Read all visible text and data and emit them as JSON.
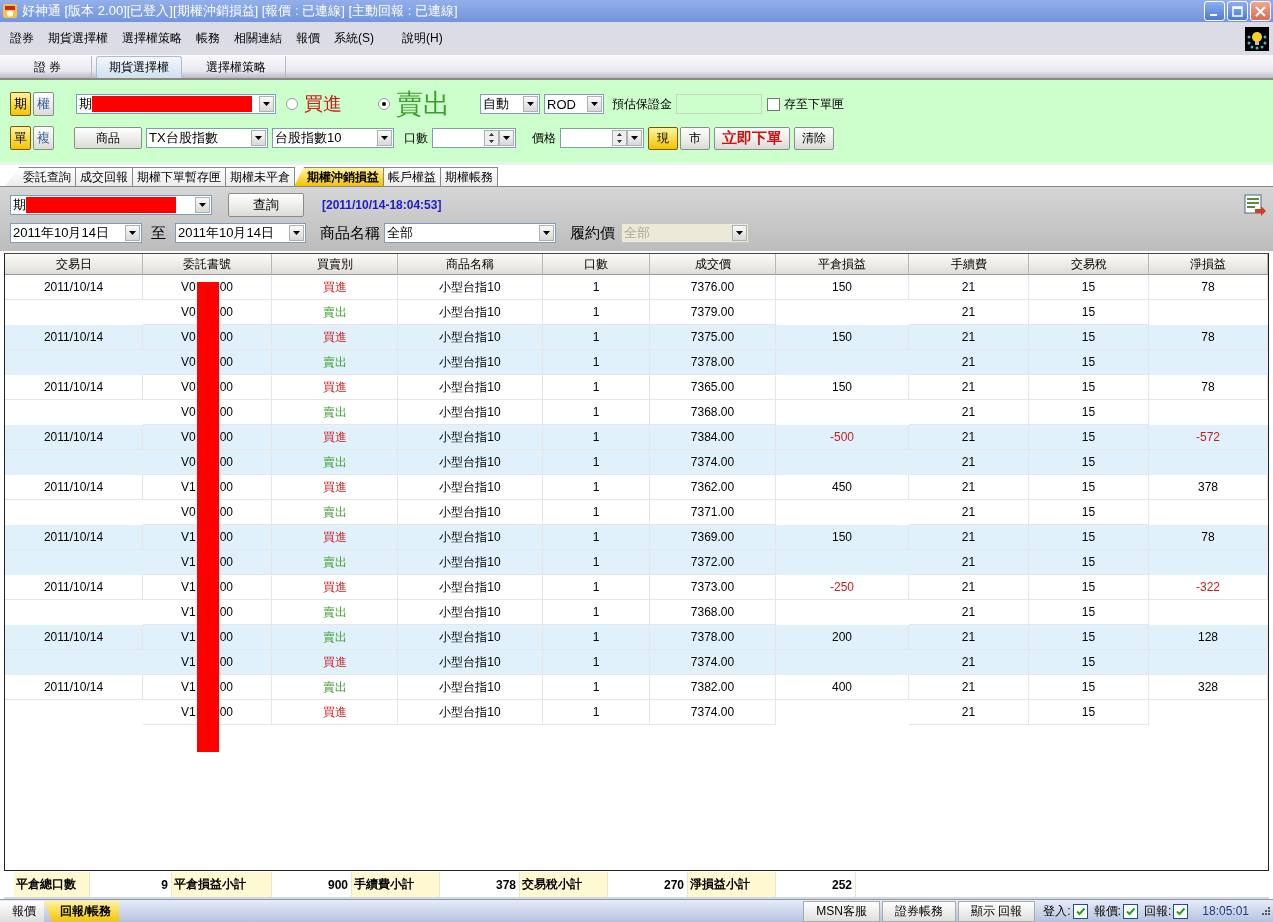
{
  "window": {
    "title": "好神通 [版本 2.00][已登入][期權沖銷損益] [報價 : 已連線] [主動回報 : 已連線]"
  },
  "menu": [
    "證券",
    "期貨選擇權",
    "選擇權策略",
    "帳務",
    "相關連結",
    "報價",
    "系統(S)",
    "說明(H)"
  ],
  "main_tabs": [
    {
      "label": "證 券",
      "selected": false
    },
    {
      "label": "期貨選擇權",
      "selected": true
    },
    {
      "label": "選擇權策略",
      "selected": false
    }
  ],
  "order_panel": {
    "market_toggle": [
      {
        "label": "期",
        "selected": true
      },
      {
        "label": "權",
        "selected": false
      }
    ],
    "account": "期",
    "side": [
      {
        "label": "買進",
        "selected": false,
        "kind": "buy"
      },
      {
        "label": "賣出",
        "selected": true,
        "kind": "sell"
      }
    ],
    "condition": "自動",
    "order_type": "ROD",
    "margin_label": "預估保證金",
    "save_to_box": {
      "label": "存至下單匣",
      "checked": false
    },
    "mode_toggle": [
      {
        "label": "單",
        "selected": true
      },
      {
        "label": "複",
        "selected": false
      }
    ],
    "product_button": "商品",
    "product_combo": "TX台股指數",
    "contract_combo": "台股指數10",
    "qty_label": "口數",
    "price_label": "價格",
    "price_type": [
      {
        "label": "現",
        "selected": true
      },
      {
        "label": "市",
        "selected": false
      }
    ],
    "submit_button": "立即下單",
    "clear_button": "清除"
  },
  "sub_tabs": [
    {
      "label": "委託查詢",
      "selected": false
    },
    {
      "label": "成交回報",
      "selected": false
    },
    {
      "label": "期權下單暫存匣",
      "selected": false
    },
    {
      "label": "期權未平倉",
      "selected": false
    },
    {
      "label": "期權沖銷損益",
      "selected": true
    },
    {
      "label": "帳戶權益",
      "selected": false
    },
    {
      "label": "期權帳務",
      "selected": false
    }
  ],
  "filter": {
    "account": "期",
    "query_button": "查詢",
    "timestamp": "[2011/10/14-18:04:53]",
    "date_from": "2011年10月14日",
    "to_label": "至",
    "date_to": "2011年10月14日",
    "product_label": "商品名稱",
    "product": "全部",
    "strike_label": "履約價",
    "strike": {
      "value": "全部",
      "disabled": true
    }
  },
  "table": {
    "columns": [
      "交易日",
      "委託書號",
      "買賣別",
      "商品名稱",
      "口數",
      "成交價",
      "平倉損益",
      "手續費",
      "交易稅",
      "淨損益"
    ],
    "rows": [
      {
        "date": "2011/10/14",
        "order_prefix": "V0",
        "order_suffix": "00",
        "side": "買進",
        "kind": "buy",
        "product": "小型台指10",
        "qty": "1",
        "price": "7376.00",
        "pnl": "150",
        "fee": "21",
        "tax": "15",
        "net": "78",
        "loss": false
      },
      {
        "order_prefix": "V0",
        "order_suffix": "00",
        "side": "賣出",
        "kind": "sell",
        "product": "小型台指10",
        "qty": "1",
        "price": "7379.00",
        "fee": "21",
        "tax": "15"
      },
      {
        "date": "2011/10/14",
        "order_prefix": "V0",
        "order_suffix": "00",
        "side": "買進",
        "kind": "buy",
        "product": "小型台指10",
        "qty": "1",
        "price": "7375.00",
        "pnl": "150",
        "fee": "21",
        "tax": "15",
        "net": "78",
        "loss": false
      },
      {
        "order_prefix": "V0",
        "order_suffix": "00",
        "side": "賣出",
        "kind": "sell",
        "product": "小型台指10",
        "qty": "1",
        "price": "7378.00",
        "fee": "21",
        "tax": "15"
      },
      {
        "date": "2011/10/14",
        "order_prefix": "V0",
        "order_suffix": "00",
        "side": "買進",
        "kind": "buy",
        "product": "小型台指10",
        "qty": "1",
        "price": "7365.00",
        "pnl": "150",
        "fee": "21",
        "tax": "15",
        "net": "78",
        "loss": false
      },
      {
        "order_prefix": "V0",
        "order_suffix": "00",
        "side": "賣出",
        "kind": "sell",
        "product": "小型台指10",
        "qty": "1",
        "price": "7368.00",
        "fee": "21",
        "tax": "15"
      },
      {
        "date": "2011/10/14",
        "order_prefix": "V0",
        "order_suffix": "00",
        "side": "買進",
        "kind": "buy",
        "product": "小型台指10",
        "qty": "1",
        "price": "7384.00",
        "pnl": "-500",
        "fee": "21",
        "tax": "15",
        "net": "-572",
        "loss": true
      },
      {
        "order_prefix": "V0",
        "order_suffix": "00",
        "side": "賣出",
        "kind": "sell",
        "product": "小型台指10",
        "qty": "1",
        "price": "7374.00",
        "fee": "21",
        "tax": "15"
      },
      {
        "date": "2011/10/14",
        "order_prefix": "V1",
        "order_suffix": "00",
        "side": "買進",
        "kind": "buy",
        "product": "小型台指10",
        "qty": "1",
        "price": "7362.00",
        "pnl": "450",
        "fee": "21",
        "tax": "15",
        "net": "378",
        "loss": false
      },
      {
        "order_prefix": "V0",
        "order_suffix": "00",
        "side": "賣出",
        "kind": "sell",
        "product": "小型台指10",
        "qty": "1",
        "price": "7371.00",
        "fee": "21",
        "tax": "15"
      },
      {
        "date": "2011/10/14",
        "order_prefix": "V1",
        "order_suffix": "00",
        "side": "買進",
        "kind": "buy",
        "product": "小型台指10",
        "qty": "1",
        "price": "7369.00",
        "pnl": "150",
        "fee": "21",
        "tax": "15",
        "net": "78",
        "loss": false
      },
      {
        "order_prefix": "V1",
        "order_suffix": "00",
        "side": "賣出",
        "kind": "sell",
        "product": "小型台指10",
        "qty": "1",
        "price": "7372.00",
        "fee": "21",
        "tax": "15"
      },
      {
        "date": "2011/10/14",
        "order_prefix": "V1",
        "order_suffix": "00",
        "side": "買進",
        "kind": "buy",
        "product": "小型台指10",
        "qty": "1",
        "price": "7373.00",
        "pnl": "-250",
        "fee": "21",
        "tax": "15",
        "net": "-322",
        "loss": true
      },
      {
        "order_prefix": "V1",
        "order_suffix": "00",
        "side": "賣出",
        "kind": "sell",
        "product": "小型台指10",
        "qty": "1",
        "price": "7368.00",
        "fee": "21",
        "tax": "15"
      },
      {
        "date": "2011/10/14",
        "order_prefix": "V1",
        "order_suffix": "00",
        "side": "賣出",
        "kind": "sell",
        "product": "小型台指10",
        "qty": "1",
        "price": "7378.00",
        "pnl": "200",
        "fee": "21",
        "tax": "15",
        "net": "128",
        "loss": false
      },
      {
        "order_prefix": "V1",
        "order_suffix": "00",
        "side": "買進",
        "kind": "buy",
        "product": "小型台指10",
        "qty": "1",
        "price": "7374.00",
        "fee": "21",
        "tax": "15"
      },
      {
        "date": "2011/10/14",
        "order_prefix": "V1",
        "order_suffix": "00",
        "side": "賣出",
        "kind": "sell",
        "product": "小型台指10",
        "qty": "1",
        "price": "7382.00",
        "pnl": "400",
        "fee": "21",
        "tax": "15",
        "net": "328",
        "loss": false
      },
      {
        "order_prefix": "V1",
        "order_suffix": "00",
        "side": "買進",
        "kind": "buy",
        "product": "小型台指10",
        "qty": "1",
        "price": "7374.00",
        "fee": "21",
        "tax": "15"
      }
    ]
  },
  "summary": [
    {
      "label": "平倉總口數",
      "value": "9"
    },
    {
      "label": "平倉損益小計",
      "value": "900"
    },
    {
      "label": "手續費小計",
      "value": "378"
    },
    {
      "label": "交易稅小計",
      "value": "270"
    },
    {
      "label": "淨損益小計",
      "value": "252"
    }
  ],
  "status_bar": {
    "tabs": [
      {
        "label": "報價",
        "selected": false
      },
      {
        "label": "回報/帳務",
        "selected": true
      }
    ],
    "buttons": [
      "MSN客服",
      "證券帳務",
      "顯示 回報"
    ],
    "indicators": [
      {
        "label": "登入:",
        "checked": true
      },
      {
        "label": "報價:",
        "checked": true
      },
      {
        "label": "回報:",
        "checked": true
      }
    ],
    "time": "18:05:01"
  }
}
